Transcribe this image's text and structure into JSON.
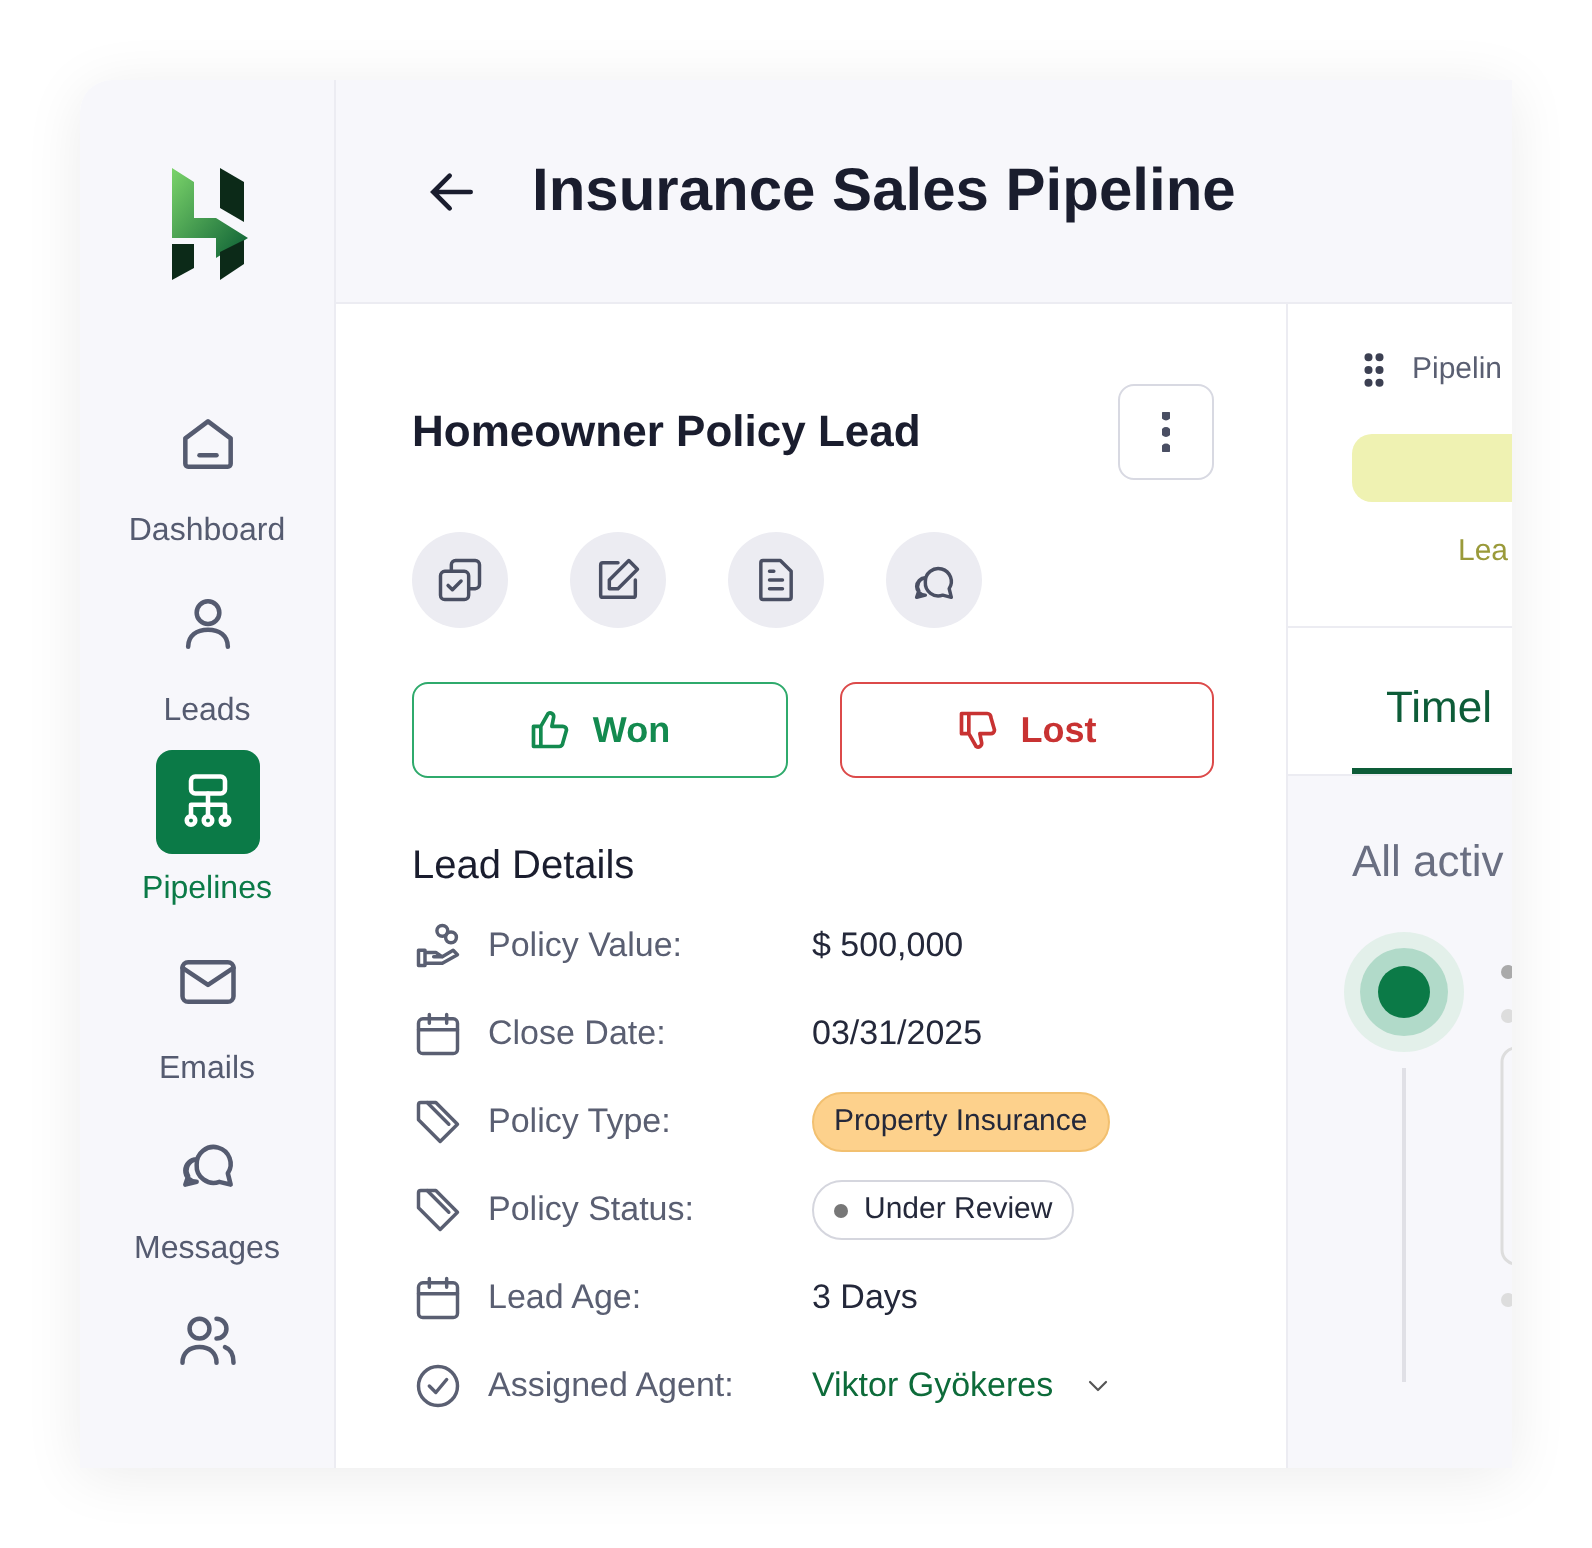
{
  "sidebar": {
    "items": [
      {
        "label": "Dashboard",
        "selected": false
      },
      {
        "label": "Leads",
        "selected": false
      },
      {
        "label": "Pipelines",
        "selected": true
      },
      {
        "label": "Emails",
        "selected": false
      },
      {
        "label": "Messages",
        "selected": false
      },
      {
        "selected": false
      }
    ]
  },
  "header": {
    "title": "Insurance Sales Pipeline"
  },
  "lead": {
    "title": "Homeowner Policy Lead",
    "outcome_buttons": [
      {
        "label": "Won",
        "kind": "won"
      },
      {
        "label": "Lost",
        "kind": "lost"
      }
    ],
    "details_title": "Lead Details",
    "details": [
      {
        "label": "Policy Value:",
        "value": "$ 500,000",
        "kind": "text"
      },
      {
        "label": "Close Date:",
        "value": "03/31/2025",
        "kind": "text"
      },
      {
        "label": "Policy Type:",
        "value": "Property Insurance",
        "kind": "tag"
      },
      {
        "label": "Policy Status:",
        "value": "Under Review",
        "kind": "status"
      },
      {
        "label": "Lead Age:",
        "value": "3 Days",
        "kind": "text"
      },
      {
        "label": "Assigned Agent:",
        "value": "Viktor Gyökeres",
        "kind": "agent"
      }
    ]
  },
  "pipeline": {
    "label": "Pipelin",
    "stage_label": "Lea",
    "tabs": [
      {
        "label": "Timel",
        "selected": true
      }
    ],
    "activity_title": "All activ"
  }
}
